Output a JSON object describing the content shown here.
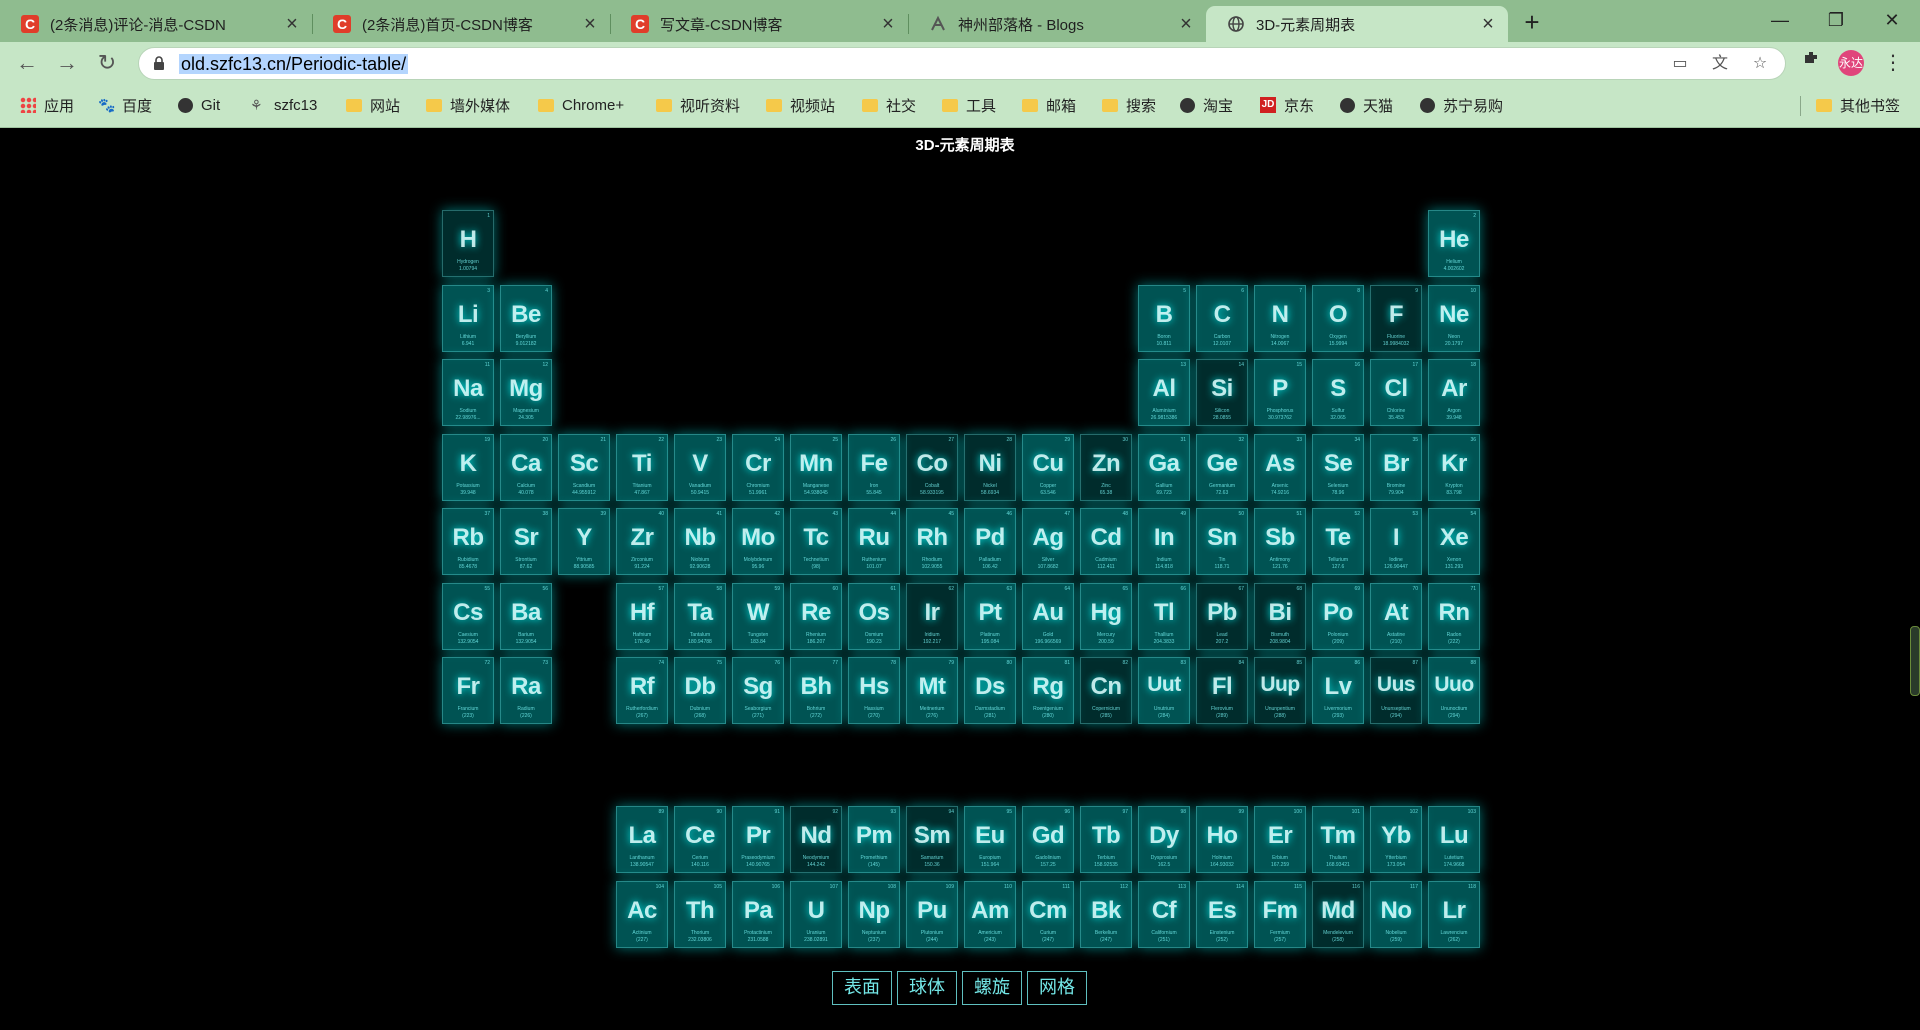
{
  "browser": {
    "tabs": [
      {
        "title": "(2条消息)评论-消息-CSDN",
        "icon": "csdn-icon"
      },
      {
        "title": "(2条消息)首页-CSDN博客",
        "icon": "csdn-icon"
      },
      {
        "title": "写文章-CSDN博客",
        "icon": "csdn-icon"
      },
      {
        "title": "神州部落格 - Blogs",
        "icon": "blogs-icon"
      },
      {
        "title": "3D-元素周期表",
        "icon": "globe-icon",
        "active": true
      }
    ],
    "url": "old.szfc13.cn/Periodic-table/",
    "profile_initials": "永达",
    "bookmarks": [
      {
        "label": "应用",
        "icon": "apps-grid-icon"
      },
      {
        "label": "百度",
        "icon": "baidu-icon"
      },
      {
        "label": "Git",
        "icon": "github-icon"
      },
      {
        "label": "szfc13",
        "icon": "site-icon"
      },
      {
        "label": "网站",
        "icon": "folder-icon"
      },
      {
        "label": "墙外媒体",
        "icon": "folder-icon"
      },
      {
        "label": "Chrome+",
        "icon": "folder-icon"
      },
      {
        "label": "视听资料",
        "icon": "folder-icon"
      },
      {
        "label": "视频站",
        "icon": "folder-icon"
      },
      {
        "label": "社交",
        "icon": "folder-icon"
      },
      {
        "label": "工具",
        "icon": "folder-icon"
      },
      {
        "label": "邮箱",
        "icon": "folder-icon"
      },
      {
        "label": "搜索",
        "icon": "folder-icon"
      },
      {
        "label": "淘宝",
        "icon": "globe-icon"
      },
      {
        "label": "京东",
        "icon": "jd-icon"
      },
      {
        "label": "天猫",
        "icon": "globe-icon"
      },
      {
        "label": "苏宁易购",
        "icon": "globe-icon"
      }
    ],
    "other_bookmarks": "其他书签"
  },
  "page": {
    "title": "3D-元素周期表",
    "menu": [
      "表面",
      "球体",
      "螺旋",
      "网格"
    ]
  },
  "elements": [
    [
      "H",
      "Hydrogen",
      "1.00794",
      1,
      1
    ],
    [
      "He",
      "Helium",
      "4.002602",
      18,
      1
    ],
    [
      "Li",
      "Lithium",
      "6.941",
      1,
      2
    ],
    [
      "Be",
      "Beryllium",
      "9.012182",
      2,
      2
    ],
    [
      "B",
      "Boron",
      "10.811",
      13,
      2
    ],
    [
      "C",
      "Carbon",
      "12.0107",
      14,
      2
    ],
    [
      "N",
      "Nitrogen",
      "14.0067",
      15,
      2
    ],
    [
      "O",
      "Oxygen",
      "15.9994",
      16,
      2
    ],
    [
      "F",
      "Fluorine",
      "18.9984032",
      17,
      2
    ],
    [
      "Ne",
      "Neon",
      "20.1797",
      18,
      2
    ],
    [
      "Na",
      "Sodium",
      "22.98976...",
      1,
      3
    ],
    [
      "Mg",
      "Magnesium",
      "24.305",
      2,
      3
    ],
    [
      "Al",
      "Aluminium",
      "26.9815386",
      13,
      3
    ],
    [
      "Si",
      "Silicon",
      "28.0855",
      14,
      3
    ],
    [
      "P",
      "Phosphorus",
      "30.973762",
      15,
      3
    ],
    [
      "S",
      "Sulfur",
      "32.065",
      16,
      3
    ],
    [
      "Cl",
      "Chlorine",
      "35.453",
      17,
      3
    ],
    [
      "Ar",
      "Argon",
      "39.948",
      18,
      3
    ],
    [
      "K",
      "Potassium",
      "39.948",
      1,
      4
    ],
    [
      "Ca",
      "Calcium",
      "40.078",
      2,
      4
    ],
    [
      "Sc",
      "Scandium",
      "44.955912",
      3,
      4
    ],
    [
      "Ti",
      "Titanium",
      "47.867",
      4,
      4
    ],
    [
      "V",
      "Vanadium",
      "50.9415",
      5,
      4
    ],
    [
      "Cr",
      "Chromium",
      "51.9961",
      6,
      4
    ],
    [
      "Mn",
      "Manganese",
      "54.938045",
      7,
      4
    ],
    [
      "Fe",
      "Iron",
      "55.845",
      8,
      4
    ],
    [
      "Co",
      "Cobalt",
      "58.933195",
      9,
      4
    ],
    [
      "Ni",
      "Nickel",
      "58.6934",
      10,
      4
    ],
    [
      "Cu",
      "Copper",
      "63.546",
      11,
      4
    ],
    [
      "Zn",
      "Zinc",
      "65.38",
      12,
      4
    ],
    [
      "Ga",
      "Gallium",
      "69.723",
      13,
      4
    ],
    [
      "Ge",
      "Germanium",
      "72.63",
      14,
      4
    ],
    [
      "As",
      "Arsenic",
      "74.9216",
      15,
      4
    ],
    [
      "Se",
      "Selenium",
      "78.96",
      16,
      4
    ],
    [
      "Br",
      "Bromine",
      "79.904",
      17,
      4
    ],
    [
      "Kr",
      "Krypton",
      "83.798",
      18,
      4
    ],
    [
      "Rb",
      "Rubidium",
      "85.4678",
      1,
      5
    ],
    [
      "Sr",
      "Strontium",
      "87.62",
      2,
      5
    ],
    [
      "Y",
      "Yttrium",
      "88.90585",
      3,
      5
    ],
    [
      "Zr",
      "Zirconium",
      "91.224",
      4,
      5
    ],
    [
      "Nb",
      "Niobium",
      "92.90628",
      5,
      5
    ],
    [
      "Mo",
      "Molybdenum",
      "95.96",
      6,
      5
    ],
    [
      "Tc",
      "Technetium",
      "(98)",
      7,
      5
    ],
    [
      "Ru",
      "Ruthenium",
      "101.07",
      8,
      5
    ],
    [
      "Rh",
      "Rhodium",
      "102.9055",
      9,
      5
    ],
    [
      "Pd",
      "Palladium",
      "106.42",
      10,
      5
    ],
    [
      "Ag",
      "Silver",
      "107.8682",
      11,
      5
    ],
    [
      "Cd",
      "Cadmium",
      "112.411",
      12,
      5
    ],
    [
      "In",
      "Indium",
      "114.818",
      13,
      5
    ],
    [
      "Sn",
      "Tin",
      "118.71",
      14,
      5
    ],
    [
      "Sb",
      "Antimony",
      "121.76",
      15,
      5
    ],
    [
      "Te",
      "Tellurium",
      "127.6",
      16,
      5
    ],
    [
      "I",
      "Iodine",
      "126.90447",
      17,
      5
    ],
    [
      "Xe",
      "Xenon",
      "131.293",
      18,
      5
    ],
    [
      "Cs",
      "Caesium",
      "132.9054",
      1,
      6
    ],
    [
      "Ba",
      "Barium",
      "132.9054",
      2,
      6
    ],
    [
      "Hf",
      "Hafnium",
      "178.49",
      4,
      6
    ],
    [
      "Ta",
      "Tantalum",
      "180.94788",
      5,
      6
    ],
    [
      "W",
      "Tungsten",
      "183.84",
      6,
      6
    ],
    [
      "Re",
      "Rhenium",
      "186.207",
      7,
      6
    ],
    [
      "Os",
      "Osmium",
      "190.23",
      8,
      6
    ],
    [
      "Ir",
      "Iridium",
      "192.217",
      9,
      6
    ],
    [
      "Pt",
      "Platinum",
      "195.084",
      10,
      6
    ],
    [
      "Au",
      "Gold",
      "196.966569",
      11,
      6
    ],
    [
      "Hg",
      "Mercury",
      "200.59",
      12,
      6
    ],
    [
      "Tl",
      "Thallium",
      "204.3833",
      13,
      6
    ],
    [
      "Pb",
      "Lead",
      "207.2",
      14,
      6
    ],
    [
      "Bi",
      "Bismuth",
      "208.9804",
      15,
      6
    ],
    [
      "Po",
      "Polonium",
      "(209)",
      16,
      6
    ],
    [
      "At",
      "Astatine",
      "(210)",
      17,
      6
    ],
    [
      "Rn",
      "Radon",
      "(222)",
      18,
      6
    ],
    [
      "Fr",
      "Francium",
      "(223)",
      1,
      7
    ],
    [
      "Ra",
      "Radium",
      "(226)",
      2,
      7
    ],
    [
      "Rf",
      "Rutherfordium",
      "(267)",
      4,
      7
    ],
    [
      "Db",
      "Dubnium",
      "(268)",
      5,
      7
    ],
    [
      "Sg",
      "Seaborgium",
      "(271)",
      6,
      7
    ],
    [
      "Bh",
      "Bohrium",
      "(272)",
      7,
      7
    ],
    [
      "Hs",
      "Hassium",
      "(270)",
      8,
      7
    ],
    [
      "Mt",
      "Meitnerium",
      "(276)",
      9,
      7
    ],
    [
      "Ds",
      "Darmstadium",
      "(281)",
      10,
      7
    ],
    [
      "Rg",
      "Roentgenium",
      "(280)",
      11,
      7
    ],
    [
      "Cn",
      "Copernicium",
      "(285)",
      12,
      7
    ],
    [
      "Uut",
      "Unutrium",
      "(284)",
      13,
      7
    ],
    [
      "Fl",
      "Flerovium",
      "(289)",
      14,
      7
    ],
    [
      "Uup",
      "Ununpentium",
      "(288)",
      15,
      7
    ],
    [
      "Lv",
      "Livermorium",
      "(293)",
      16,
      7
    ],
    [
      "Uus",
      "Ununseptium",
      "(294)",
      17,
      7
    ],
    [
      "Uuo",
      "Ununoctium",
      "(294)",
      18,
      7
    ],
    [
      "La",
      "Lanthanum",
      "138.90547",
      4,
      9
    ],
    [
      "Ce",
      "Cerium",
      "140.116",
      5,
      9
    ],
    [
      "Pr",
      "Praseodymium",
      "140.90765",
      6,
      9
    ],
    [
      "Nd",
      "Neodymium",
      "144.242",
      7,
      9
    ],
    [
      "Pm",
      "Promethium",
      "(145)",
      8,
      9
    ],
    [
      "Sm",
      "Samarium",
      "150.36",
      9,
      9
    ],
    [
      "Eu",
      "Europium",
      "151.964",
      10,
      9
    ],
    [
      "Gd",
      "Gadolinium",
      "157.25",
      11,
      9
    ],
    [
      "Tb",
      "Terbium",
      "158.92535",
      12,
      9
    ],
    [
      "Dy",
      "Dysprosium",
      "162.5",
      13,
      9
    ],
    [
      "Ho",
      "Holmium",
      "164.93032",
      14,
      9
    ],
    [
      "Er",
      "Erbium",
      "167.259",
      15,
      9
    ],
    [
      "Tm",
      "Thulium",
      "168.93421",
      16,
      9
    ],
    [
      "Yb",
      "Ytterbium",
      "173.054",
      17,
      9
    ],
    [
      "Lu",
      "Lutetium",
      "174.9668",
      18,
      9
    ],
    [
      "Ac",
      "Actinium",
      "(227)",
      4,
      10
    ],
    [
      "Th",
      "Thorium",
      "232.03806",
      5,
      10
    ],
    [
      "Pa",
      "Protactinium",
      "231.0588",
      6,
      10
    ],
    [
      "U",
      "Uranium",
      "238.02891",
      7,
      10
    ],
    [
      "Np",
      "Neptunium",
      "(237)",
      8,
      10
    ],
    [
      "Pu",
      "Plutonium",
      "(244)",
      9,
      10
    ],
    [
      "Am",
      "Americium",
      "(243)",
      10,
      10
    ],
    [
      "Cm",
      "Curium",
      "(247)",
      11,
      10
    ],
    [
      "Bk",
      "Berkelium",
      "(247)",
      12,
      10
    ],
    [
      "Cf",
      "Californium",
      "(251)",
      13,
      10
    ],
    [
      "Es",
      "Einstenium",
      "(252)",
      14,
      10
    ],
    [
      "Fm",
      "Fermium",
      "(257)",
      15,
      10
    ],
    [
      "Md",
      "Mendelevium",
      "(258)",
      16,
      10
    ],
    [
      "No",
      "Nobelium",
      "(259)",
      17,
      10
    ],
    [
      "Lr",
      "Lawrencium",
      "(262)",
      18,
      10
    ]
  ],
  "dark_symbols": [
    "H",
    "F",
    "Si",
    "Zn",
    "Ni",
    "Co",
    "Ir",
    "Pb",
    "Bi",
    "Nd",
    "Sm",
    "Md",
    "Uup",
    "Uus",
    "Fl",
    "Cn"
  ]
}
